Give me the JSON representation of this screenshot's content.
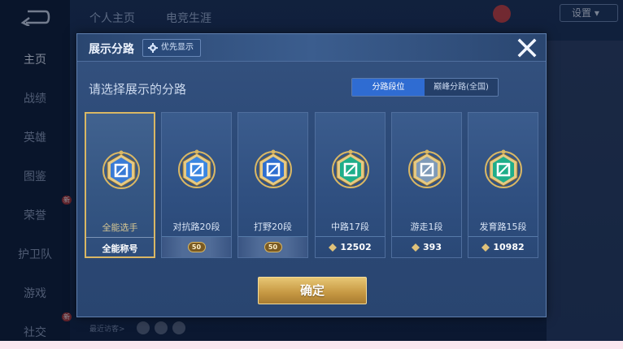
{
  "background": {
    "sidebar_items": [
      {
        "label": "主页",
        "active": true
      },
      {
        "label": "战绩"
      },
      {
        "label": "英雄"
      },
      {
        "label": "图鉴"
      },
      {
        "label": "荣誉",
        "badge": "新"
      },
      {
        "label": "护卫队"
      },
      {
        "label": "游戏"
      },
      {
        "label": "社交",
        "badge": "新"
      }
    ],
    "top_tabs": [
      "个人主页",
      "电竞生涯"
    ],
    "top_right_label": "设置",
    "visitors_label": "最近访客>"
  },
  "dialog": {
    "title": "展示分路",
    "priority_label": "优先显示",
    "subtitle": "请选择展示的分路",
    "segments": [
      {
        "label": "分路段位",
        "active": true
      },
      {
        "label": "巅峰分路(全国)",
        "active": false
      }
    ],
    "cards": [
      {
        "name": "全能选手",
        "footer": "全能称号",
        "footer_type": "text",
        "selected": true,
        "emblem_color": "#3a7bd5",
        "emblem": "allround-emblem-icon"
      },
      {
        "name": "对抗路20段",
        "footer": "50",
        "footer_type": "rank",
        "selected": false,
        "emblem_color": "#3a86e0",
        "emblem": "clash-lane-emblem-icon"
      },
      {
        "name": "打野20段",
        "footer": "50",
        "footer_type": "rank",
        "selected": false,
        "emblem_color": "#2f6fd0",
        "emblem": "jungle-emblem-icon"
      },
      {
        "name": "中路17段",
        "footer": "12502",
        "footer_type": "score",
        "selected": false,
        "emblem_color": "#1fae8a",
        "emblem": "mid-lane-emblem-icon"
      },
      {
        "name": "游走1段",
        "footer": "393",
        "footer_type": "score",
        "selected": false,
        "emblem_color": "#7f9ab8",
        "emblem": "roam-emblem-icon"
      },
      {
        "name": "发育路15段",
        "footer": "10982",
        "footer_type": "score",
        "selected": false,
        "emblem_color": "#1fae8a",
        "emblem": "farm-lane-emblem-icon"
      }
    ],
    "confirm_label": "确定"
  },
  "colors": {
    "accent_gold": "#d9b764",
    "segment_active": "#2f6cd2"
  }
}
